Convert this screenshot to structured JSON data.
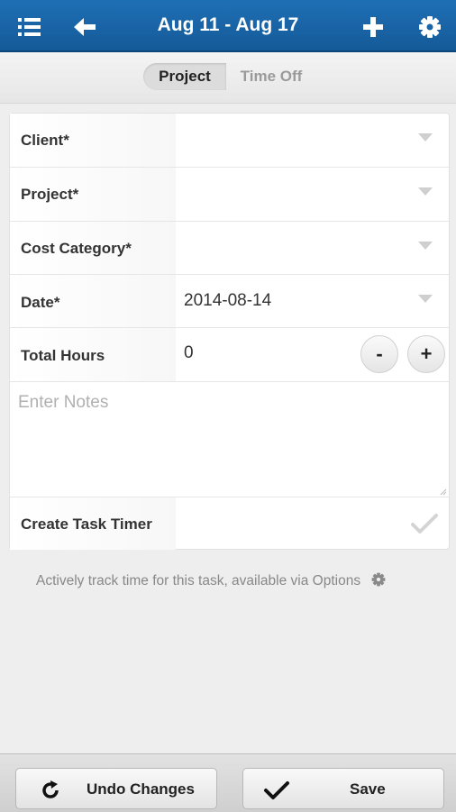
{
  "header": {
    "title": "Aug 11 - Aug 17",
    "menu_icon": "list-menu-icon",
    "back_icon": "back-arrow-icon",
    "add_icon": "plus-icon",
    "settings_icon": "gear-icon",
    "background": "#1a64a7"
  },
  "tabs": [
    {
      "label": "Project",
      "active": true
    },
    {
      "label": "Time Off",
      "active": false
    }
  ],
  "form": {
    "client": {
      "label": "Client",
      "required_mark": "*",
      "value": ""
    },
    "project": {
      "label": "Project",
      "required_mark": "*",
      "value": ""
    },
    "cost_category": {
      "label": "Cost Category",
      "required_mark": "*",
      "value": ""
    },
    "date": {
      "label": "Date",
      "required_mark": "*",
      "value": "2014-08-14"
    },
    "total_hours": {
      "label": "Total Hours",
      "value": "0",
      "decrement": "-",
      "increment": "+"
    },
    "notes": {
      "placeholder": "Enter Notes",
      "value": ""
    },
    "task_timer": {
      "label": "Create Task Timer",
      "checked": false,
      "icon": "checkmark-icon"
    }
  },
  "hint": {
    "text": "Actively track time for this task, available via Options",
    "icon": "gear-icon"
  },
  "footer": {
    "undo": {
      "label": "Undo Changes",
      "icon": "refresh-icon"
    },
    "save": {
      "label": "Save",
      "icon": "checkmark-icon"
    }
  }
}
